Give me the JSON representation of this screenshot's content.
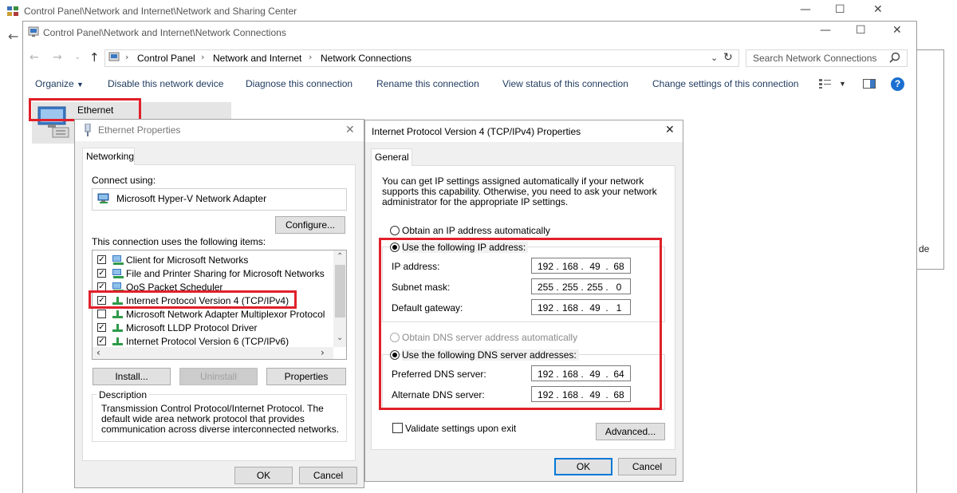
{
  "background_window": {
    "title": "Control Panel\\Network and Internet\\Network and Sharing Center",
    "partial_text": "de"
  },
  "connections_window": {
    "title": "Control Panel\\Network and Internet\\Network Connections",
    "breadcrumb": [
      "Control Panel",
      "Network and Internet",
      "Network Connections"
    ],
    "search_placeholder": "Search Network Connections",
    "toolbar": {
      "organize": "Organize",
      "disable": "Disable this network device",
      "diagnose": "Diagnose this connection",
      "rename": "Rename this connection",
      "view_status": "View status of this connection",
      "change_settings": "Change settings of this connection"
    },
    "adapter_name": "Ethernet"
  },
  "ethernet_properties": {
    "title": "Ethernet Properties",
    "tab": "Networking",
    "connect_using_label": "Connect using:",
    "adapter": "Microsoft Hyper-V Network Adapter",
    "configure_button": "Configure...",
    "items_label": "This connection uses the following items:",
    "items": [
      {
        "label": "Client for Microsoft Networks",
        "checked": true,
        "icon": "network-client-icon"
      },
      {
        "label": "File and Printer Sharing for Microsoft Networks",
        "checked": true,
        "icon": "network-client-icon"
      },
      {
        "label": "QoS Packet Scheduler",
        "checked": true,
        "icon": "network-client-icon"
      },
      {
        "label": "Internet Protocol Version 4 (TCP/IPv4)",
        "checked": true,
        "icon": "protocol-icon"
      },
      {
        "label": "Microsoft Network Adapter Multiplexor Protocol",
        "checked": false,
        "icon": "protocol-icon"
      },
      {
        "label": "Microsoft LLDP Protocol Driver",
        "checked": true,
        "icon": "protocol-icon"
      },
      {
        "label": "Internet Protocol Version 6 (TCP/IPv6)",
        "checked": true,
        "icon": "protocol-icon"
      }
    ],
    "install_button": "Install...",
    "uninstall_button": "Uninstall",
    "properties_button": "Properties",
    "description_label": "Description",
    "description_text": "Transmission Control Protocol/Internet Protocol. The default wide area network protocol that provides communication across diverse interconnected networks.",
    "ok_button": "OK",
    "cancel_button": "Cancel"
  },
  "ipv4_properties": {
    "title": "Internet Protocol Version 4 (TCP/IPv4) Properties",
    "tab": "General",
    "intro": "You can get IP settings assigned automatically if your network supports this capability. Otherwise, you need to ask your network administrator for the appropriate IP settings.",
    "obtain_ip_auto": "Obtain an IP address automatically",
    "use_following_ip": "Use the following IP address:",
    "ip_label": "IP address:",
    "ip": [
      "192",
      "168",
      "49",
      "68"
    ],
    "subnet_label": "Subnet mask:",
    "subnet": [
      "255",
      "255",
      "255",
      "0"
    ],
    "gateway_label": "Default gateway:",
    "gateway": [
      "192",
      "168",
      "49",
      "1"
    ],
    "obtain_dns_auto": "Obtain DNS server address automatically",
    "use_following_dns": "Use the following DNS server addresses:",
    "preferred_dns_label": "Preferred DNS server:",
    "preferred_dns": [
      "192",
      "168",
      "49",
      "64"
    ],
    "alternate_dns_label": "Alternate DNS server:",
    "alternate_dns": [
      "192",
      "168",
      "49",
      "68"
    ],
    "validate_label": "Validate settings upon exit",
    "advanced_button": "Advanced...",
    "ok_button": "OK",
    "cancel_button": "Cancel"
  },
  "colors": {
    "highlight_red": "#e0202a",
    "dialog_bg": "#f0f0f0",
    "accent_blue": "#0078d7"
  }
}
